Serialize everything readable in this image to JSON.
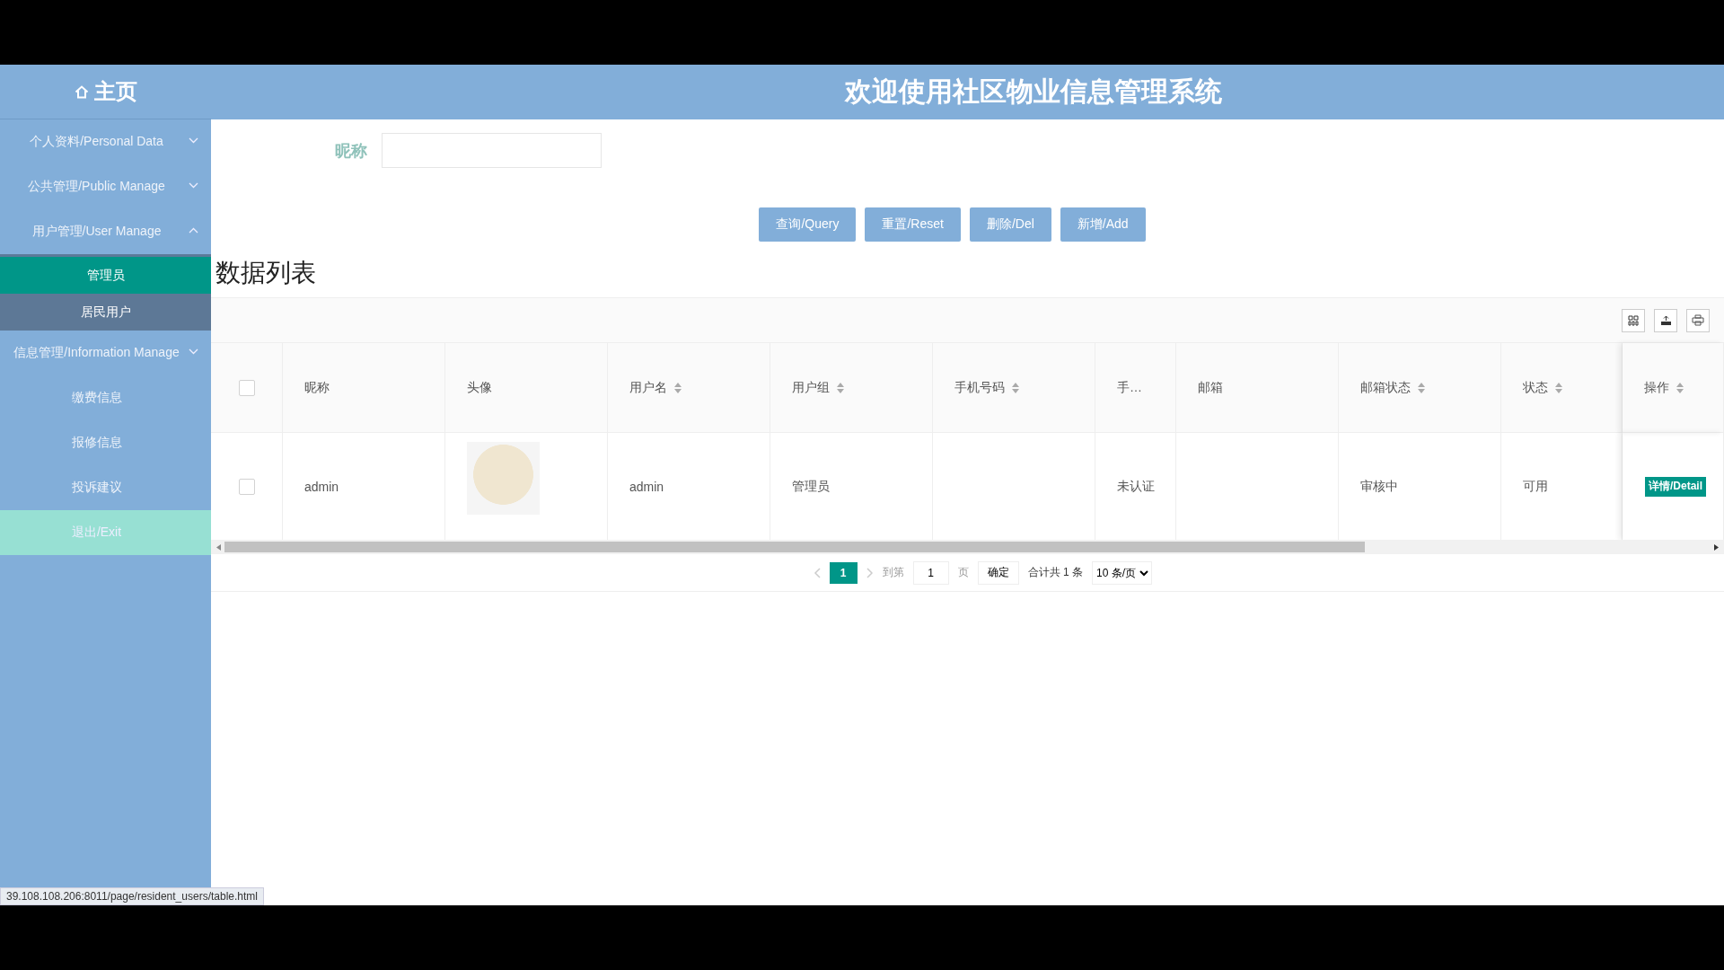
{
  "sidebar": {
    "home_label": "主页",
    "menu": [
      {
        "kind": "group",
        "label": "个人资料/Personal Data",
        "expanded": false
      },
      {
        "kind": "group",
        "label": "公共管理/Public Manage",
        "expanded": false
      },
      {
        "kind": "group",
        "label": "用户管理/User Manage",
        "expanded": true,
        "children": [
          {
            "label": "管理员",
            "selected": true,
            "hovered": false
          },
          {
            "label": "居民用户",
            "selected": false,
            "hovered": true
          }
        ]
      },
      {
        "kind": "group",
        "label": "信息管理/Information Manage",
        "expanded": false
      },
      {
        "kind": "link",
        "label": "缴费信息"
      },
      {
        "kind": "link",
        "label": "报修信息"
      },
      {
        "kind": "link",
        "label": "投诉建议"
      },
      {
        "kind": "exit",
        "label": "退出/Exit"
      }
    ]
  },
  "header": {
    "title": "欢迎使用社区物业信息管理系统"
  },
  "search": {
    "label": "昵称"
  },
  "buttons": [
    "查询/Query",
    "重置/Reset",
    "删除/Del",
    "新增/Add"
  ],
  "section_title": "数据列表",
  "table": {
    "header_checked": false,
    "columns": [
      {
        "label": "昵称",
        "sortable": false
      },
      {
        "label": "头像",
        "sortable": false
      },
      {
        "label": "用户名",
        "sortable": true
      },
      {
        "label": "用户组",
        "sortable": true
      },
      {
        "label": "手机号码",
        "sortable": true
      },
      {
        "label": "手…",
        "sortable": false
      },
      {
        "label": "邮箱",
        "sortable": false
      },
      {
        "label": "邮箱状态",
        "sortable": true
      },
      {
        "label": "状态",
        "sortable": true
      },
      {
        "label": "操作",
        "sortable": true
      }
    ],
    "rows": [
      {
        "checked": false,
        "cells": [
          {
            "kind": "text",
            "value": "admin"
          },
          {
            "kind": "image"
          },
          {
            "kind": "text",
            "value": "admin"
          },
          {
            "kind": "text",
            "value": "管理员"
          },
          {
            "kind": "text"
          },
          {
            "kind": "text",
            "value": "未认证"
          },
          {
            "kind": "text"
          },
          {
            "kind": "text",
            "value": "审核中"
          },
          {
            "kind": "text",
            "value": "可用"
          },
          {
            "kind": "button",
            "value": "详情/Detail"
          }
        ]
      }
    ]
  },
  "pagination": {
    "current": "1",
    "goto_label": "到第",
    "goto_value": "1",
    "page_label": "页",
    "confirm": "确定",
    "total": "合计共 1 条",
    "page_size": "10 条/页"
  },
  "status_url": "39.108.108.206:8011/page/resident_users/table.html"
}
